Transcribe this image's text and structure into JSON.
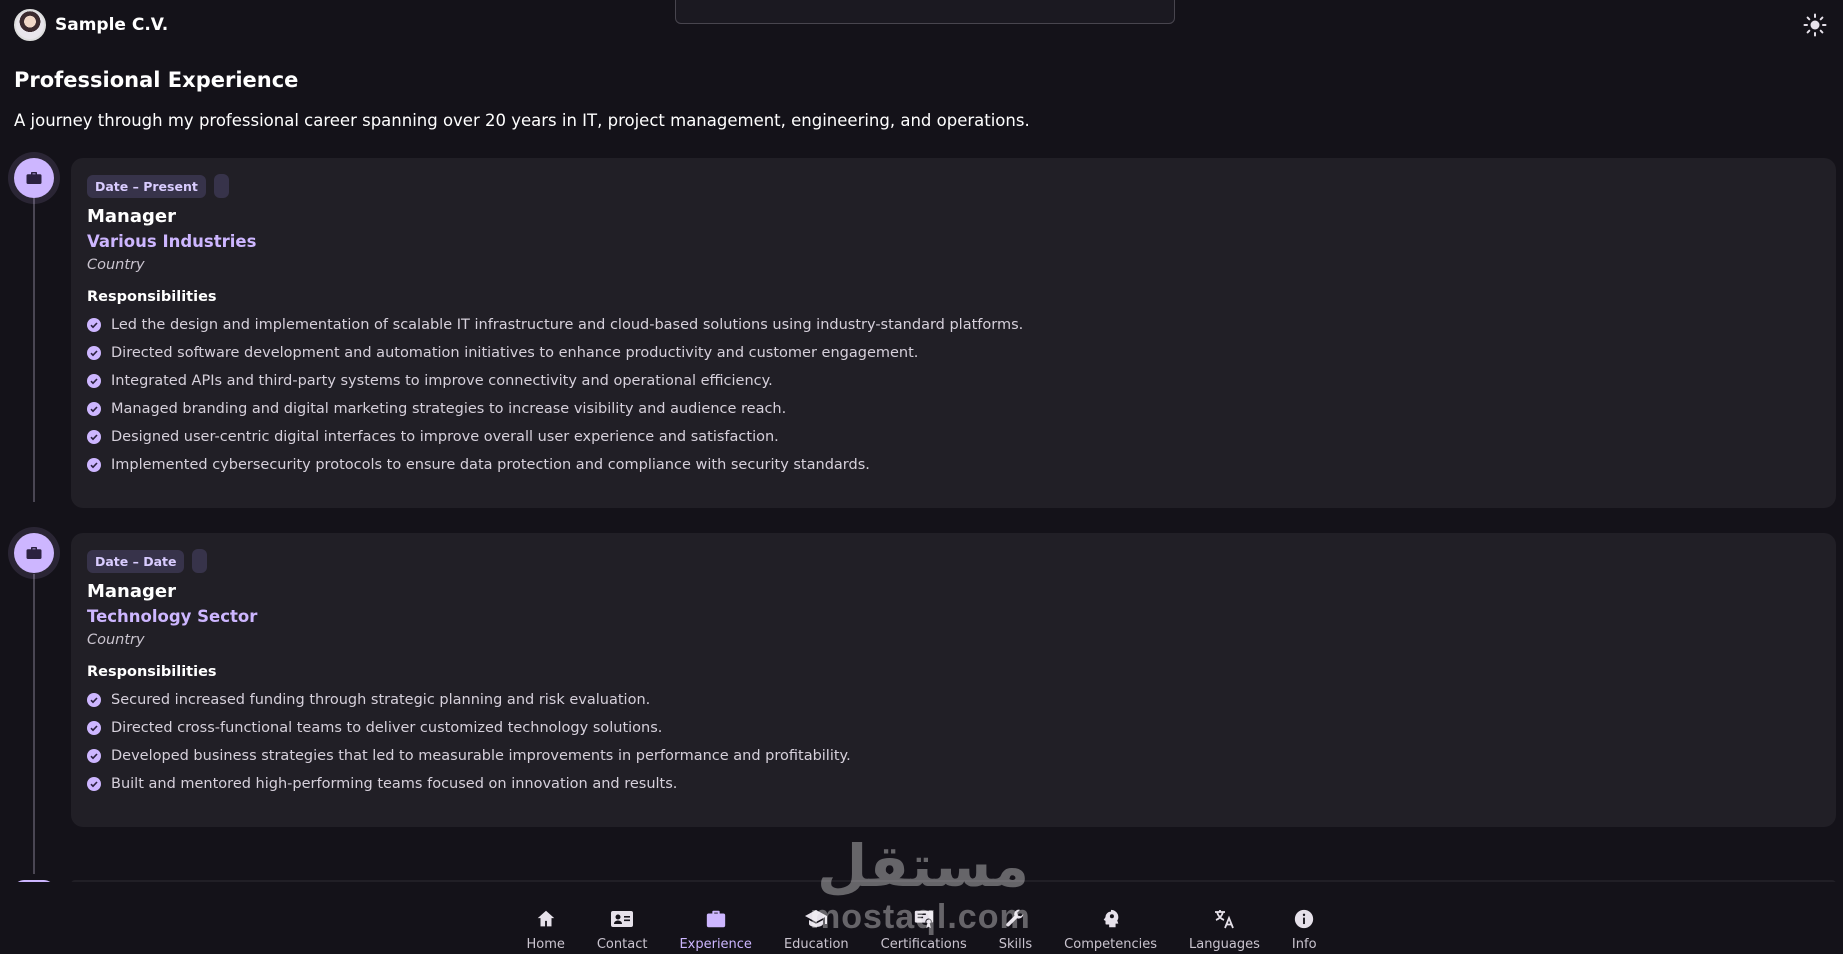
{
  "brand": {
    "name": "Sample C.V."
  },
  "section": {
    "title": "Professional Experience",
    "subtitle": "A journey through my professional career spanning over 20 years in IT, project management, engineering, and operations."
  },
  "experiences": [
    {
      "date": "Date – Present",
      "role": "Manager",
      "company": "Various Industries",
      "location": "Country",
      "responsibilities_label": "Responsibilities",
      "responsibilities": [
        "Led the design and implementation of scalable IT infrastructure and cloud-based solutions using industry-standard platforms.",
        "Directed software development and automation initiatives to enhance productivity and customer engagement.",
        "Integrated APIs and third-party systems to improve connectivity and operational efficiency.",
        "Managed branding and digital marketing strategies to increase visibility and audience reach.",
        "Designed user-centric digital interfaces to improve overall user experience and satisfaction.",
        "Implemented cybersecurity protocols to ensure data protection and compliance with security standards."
      ]
    },
    {
      "date": "Date – Date",
      "role": "Manager",
      "company": "Technology Sector",
      "location": "Country",
      "responsibilities_label": "Responsibilities",
      "responsibilities": [
        "Secured increased funding through strategic planning and risk evaluation.",
        "Directed cross-functional teams to deliver customized technology solutions.",
        "Developed business strategies that led to measurable improvements in performance and profitability.",
        "Built and mentored high-performing teams focused on innovation and results."
      ]
    }
  ],
  "nav": {
    "items": [
      {
        "label": "Home",
        "icon": "home-icon"
      },
      {
        "label": "Contact",
        "icon": "contact-card-icon"
      },
      {
        "label": "Experience",
        "icon": "briefcase-icon",
        "active": true
      },
      {
        "label": "Education",
        "icon": "graduation-cap-icon"
      },
      {
        "label": "Certifications",
        "icon": "certificate-icon"
      },
      {
        "label": "Skills",
        "icon": "wrench-icon"
      },
      {
        "label": "Competencies",
        "icon": "head-gear-icon"
      },
      {
        "label": "Languages",
        "icon": "translate-icon"
      },
      {
        "label": "Info",
        "icon": "info-icon"
      }
    ]
  },
  "watermark": {
    "arabic": "مستقل",
    "latin": "mostaql.com"
  },
  "colors": {
    "background": "#141219",
    "card": "#211f26",
    "accent": "#cdb6ff",
    "text": "#ffffff"
  }
}
